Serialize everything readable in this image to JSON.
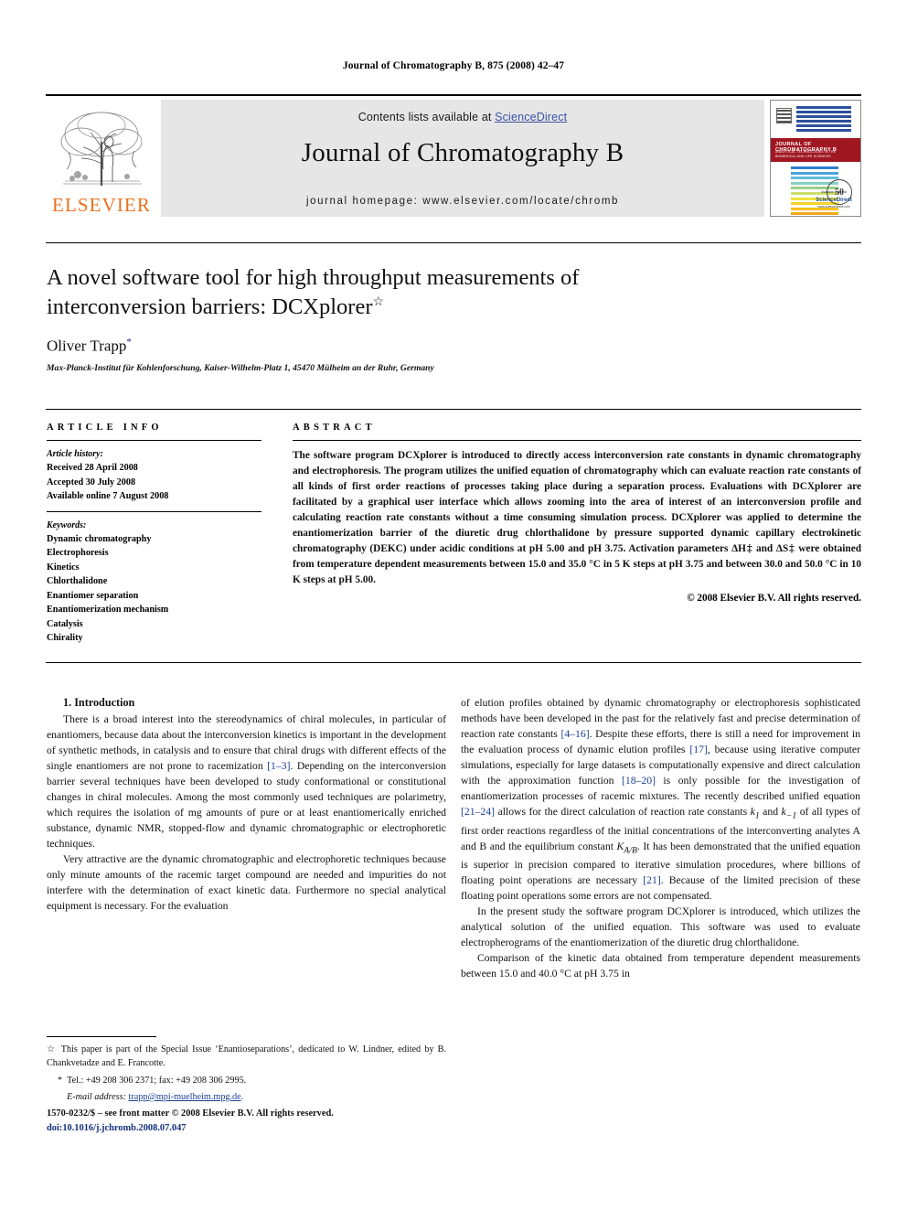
{
  "running_head": "Journal of Chromatography B, 875 (2008) 42–47",
  "masthead": {
    "publisher_logo_text": "ELSEVIER",
    "contents_line_prefix": "Contents lists available at ",
    "contents_link": "ScienceDirect",
    "journal_title": "Journal of Chromatography B",
    "homepage_line": "journal homepage: www.elsevier.com/locate/chromb",
    "cover": {
      "band_title": "JOURNAL OF CHROMATOGRAPHY B",
      "band_subtitle": "ANALYTICAL TECHNOLOGIES IN THE BIOMEDICAL AND LIFE SCIENCES",
      "seal_text": "50",
      "foot_small_top": "Available online at",
      "foot_big": "ScienceDirect",
      "foot_small_bottom": "www.sciencedirect.com"
    }
  },
  "article": {
    "title": "A novel software tool for high throughput measurements of interconversion barriers: DCXplorer",
    "title_footnote_marker": "☆",
    "author": "Oliver Trapp",
    "author_footnote_marker": "*",
    "affiliation": "Max-Planck-Institut für Kohlenforschung, Kaiser-Wilhelm-Platz 1, 45470 Mülheim an der Ruhr, Germany"
  },
  "info": {
    "heading": "ARTICLE INFO",
    "history_label": "Article history:",
    "history": [
      "Received 28 April 2008",
      "Accepted 30 July 2008",
      "Available online 7 August 2008"
    ],
    "keywords_label": "Keywords:",
    "keywords": [
      "Dynamic chromatography",
      "Electrophoresis",
      "Kinetics",
      "Chlorthalidone",
      "Enantiomer separation",
      "Enantiomerization mechanism",
      "Catalysis",
      "Chirality"
    ]
  },
  "abstract": {
    "heading": "ABSTRACT",
    "text": "The software program DCXplorer is introduced to directly access interconversion rate constants in dynamic chromatography and electrophoresis. The program utilizes the unified equation of chromatography which can evaluate reaction rate constants of all kinds of first order reactions of processes taking place during a separation process. Evaluations with DCXplorer are facilitated by a graphical user interface which allows zooming into the area of interest of an interconversion profile and calculating reaction rate constants without a time consuming simulation process. DCXplorer was applied to determine the enantiomerization barrier of the diuretic drug chlorthalidone by pressure supported dynamic capillary electrokinetic chromatography (DEKC) under acidic conditions at pH 5.00 and pH 3.75. Activation parameters ΔH‡ and ΔS‡ were obtained from temperature dependent measurements between 15.0 and 35.0 °C in 5 K steps at pH 3.75 and between 30.0 and 50.0 °C in 10 K steps at pH 5.00.",
    "copyright": "© 2008 Elsevier B.V. All rights reserved."
  },
  "body": {
    "section_number_title": "1. Introduction",
    "left_paragraphs": [
      {
        "parts": [
          {
            "t": "There is a broad interest into the stereodynamics of chiral molecules, in particular of enantiomers, because data about the interconversion kinetics is important in the development of synthetic methods, in catalysis and to ensure that chiral drugs with different effects of the single enantiomers are not prone to racemization "
          },
          {
            "t": "[1–3]",
            "ref": true
          },
          {
            "t": ". Depending on the interconversion barrier several techniques have been developed to study conformational or constitutional changes in chiral molecules. Among the most commonly used techniques are polarimetry, which requires the isolation of mg amounts of pure or at least enantiomerically enriched substance, dynamic NMR, stopped-flow and dynamic chromatographic or electrophoretic techniques."
          }
        ]
      },
      {
        "parts": [
          {
            "t": "Very attractive are the dynamic chromatographic and electrophoretic techniques because only minute amounts of the racemic target compound are needed and impurities do not interfere with the determination of exact kinetic data. Furthermore no special analytical equipment is necessary. For the evaluation"
          }
        ]
      }
    ],
    "right_paragraphs": [
      {
        "parts": [
          {
            "t": "of elution profiles obtained by dynamic chromatography or electrophoresis sophisticated methods have been developed in the past for the relatively fast and precise determination of reaction rate constants "
          },
          {
            "t": "[4–16]",
            "ref": true
          },
          {
            "t": ". Despite these efforts, there is still a need for improvement in the evaluation process of dynamic elution profiles "
          },
          {
            "t": "[17]",
            "ref": true
          },
          {
            "t": ", because using iterative computer simulations, especially for large datasets is computationally expensive and direct calculation with the approximation function "
          },
          {
            "t": "[18–20]",
            "ref": true
          },
          {
            "t": " is only possible for the investigation of enantiomerization processes of racemic mixtures. The recently described unified equation "
          },
          {
            "t": "[21–24]",
            "ref": true
          },
          {
            "t": " allows for the direct calculation of reaction rate constants "
          },
          {
            "t": "k1",
            "sub": "1",
            "italic": true
          },
          {
            "t": " and "
          },
          {
            "t": "k−1",
            "sub": "−1",
            "italic": true
          },
          {
            "t": " of all types of first order reactions regardless of the initial concentrations of the interconverting analytes A and B and the equilibrium constant "
          },
          {
            "t": "KA/B",
            "sub": "A/B",
            "italic": true
          },
          {
            "t": ". It has been demonstrated that the unified equation is superior in precision compared to iterative simulation procedures, where billions of floating point operations are necessary "
          },
          {
            "t": "[21]",
            "ref": true
          },
          {
            "t": ". Because of the limited precision of these floating point operations some errors are not compensated."
          }
        ]
      },
      {
        "parts": [
          {
            "t": "In the present study the software program DCXplorer is introduced, which utilizes the analytical solution of the unified equation. This software was used to evaluate electropherograms of the enantiomerization of the diuretic drug chlorthalidone."
          }
        ]
      },
      {
        "parts": [
          {
            "t": "Comparison of the kinetic data obtained from temperature dependent measurements between 15.0 and 40.0 °C at pH 3.75 in"
          }
        ]
      }
    ]
  },
  "footnotes": {
    "special_issue_marker": "☆",
    "special_issue": "This paper is part of the Special Issue ‘Enantioseparations’, dedicated to W. Lindner, edited by B. Chankvetadze and E. Francotte.",
    "corresponding_marker": "*",
    "corresponding": "Tel.: +49 208 306 2371; fax: +49 208 306 2995.",
    "email_label": "E-mail address:",
    "email": "trapp@mpi-muelheim.mpg.de"
  },
  "imprint": {
    "front_matter": "1570-0232/$ – see front matter © 2008 Elsevier B.V. All rights reserved.",
    "doi": "doi:10.1016/j.jchromb.2008.07.047"
  },
  "colors": {
    "elsevier_orange": "#E9711C",
    "link_blue": "#3a53a4",
    "reference_blue": "#1b3f94",
    "cover_red": "#a01722",
    "banner_gray": "#e6e6e6"
  }
}
